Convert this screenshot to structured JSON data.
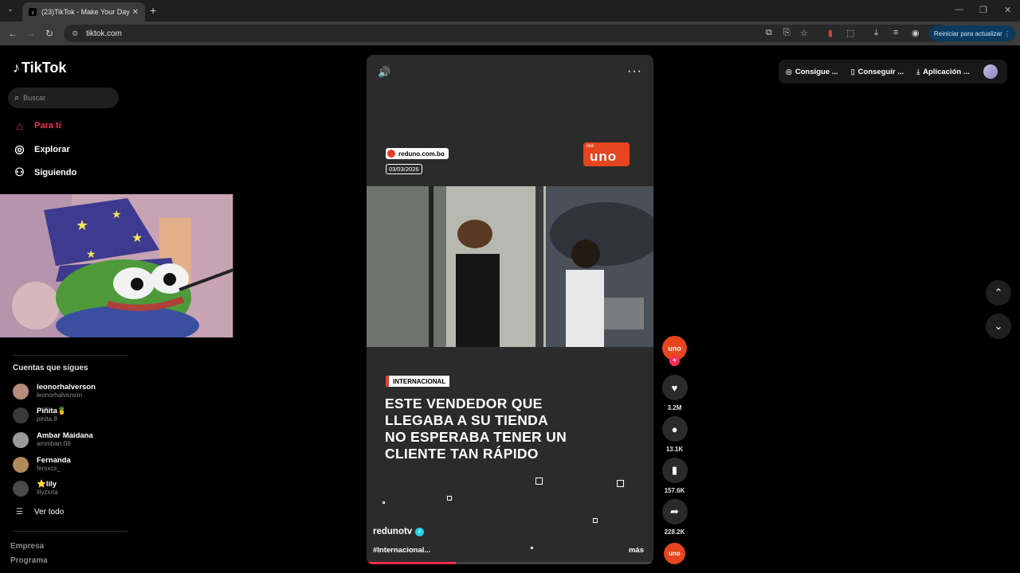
{
  "browser": {
    "tab_title": "(23)TikTok - Make Your Day",
    "tab_close": "✕",
    "new_tab": "+",
    "url": "tiktok.com",
    "update_button": "Reiniciar para actualizar ⋮",
    "window_controls": [
      "—",
      "❐",
      "✕"
    ]
  },
  "sidebar": {
    "logo": "TikTok",
    "search_placeholder": "Buscar",
    "nav": [
      {
        "label": "Para ti",
        "icon": "home-icon",
        "active": true
      },
      {
        "label": "Explorar",
        "icon": "compass-icon"
      },
      {
        "label": "Siguiendo",
        "icon": "following-icon"
      }
    ],
    "following_title": "Cuentas que sigues",
    "accounts": [
      {
        "name": "leonorhalverson",
        "handle": "leonorhalverson",
        "color": "#b78c7c"
      },
      {
        "name": "Piñita🍍",
        "handle": "pinita.8",
        "color": "#3a3a3a"
      },
      {
        "name": "Ambar Maidana",
        "handle": "ammbarr.06",
        "color": "#9a9a9a"
      },
      {
        "name": "Fernanda",
        "handle": "fersxcs_",
        "color": "#b08a5a"
      },
      {
        "name": "⭐lily",
        "handle": "lilyzxrta",
        "color": "#4a4a4a"
      }
    ],
    "see_all": "Ver todo",
    "footer": [
      "Empresa",
      "Programa"
    ]
  },
  "video": {
    "source": "reduno.com.bo",
    "date": "03/03/2026",
    "channel_logo_small": "red",
    "channel_logo_big": "uno",
    "category": "INTERNACIONAL",
    "headline_lines": [
      "ESTE VENDEDOR QUE",
      "LLEGABA A SU TIENDA",
      "NO ESPERABA TENER UN",
      "CLIENTE TAN RÁPIDO"
    ],
    "author": "redunotv",
    "hashtags": "#Internacional...",
    "more": "más",
    "progress": 0.31
  },
  "actions": {
    "avatar_text": "uno",
    "likes": "3.2M",
    "comments": "13.1K",
    "saves": "157.6K",
    "shares": "228.2K"
  },
  "top_right": {
    "items": [
      {
        "label": "Consigue ...",
        "icon": "coin-icon"
      },
      {
        "label": "Conseguir ...",
        "icon": "phone-icon"
      },
      {
        "label": "Aplicación ...",
        "icon": "download-icon"
      }
    ]
  },
  "colors": {
    "accent": "#fe2c55",
    "brand_uno": "#e5451f",
    "background": "#000000"
  }
}
